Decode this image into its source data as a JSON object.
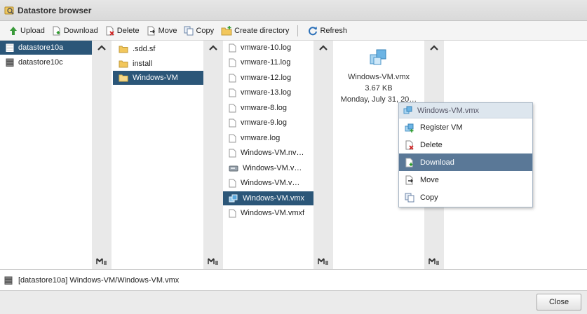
{
  "window": {
    "title": "Datastore browser"
  },
  "toolbar": {
    "upload": "Upload",
    "download": "Download",
    "delete": "Delete",
    "move": "Move",
    "copy": "Copy",
    "create_directory": "Create directory",
    "refresh": "Refresh"
  },
  "datastores": [
    "datastore10a",
    "datastore10c"
  ],
  "folders": [
    ".sdd.sf",
    "install",
    "Windows-VM"
  ],
  "files": [
    "vmware-10.log",
    "vmware-11.log",
    "vmware-12.log",
    "vmware-13.log",
    "vmware-8.log",
    "vmware-9.log",
    "vmware.log",
    "Windows-VM.nv…",
    "Windows-VM.v…",
    "Windows-VM.v…",
    "Windows-VM.vmx",
    "Windows-VM.vmxf"
  ],
  "preview": {
    "name": "Windows-VM.vmx",
    "size": "3.67 KB",
    "date": "Monday, July 31, 20…"
  },
  "context_menu": {
    "header": "Windows-VM.vmx",
    "register_vm": "Register VM",
    "delete": "Delete",
    "download": "Download",
    "move": "Move",
    "copy": "Copy"
  },
  "status": {
    "path": "[datastore10a] Windows-VM/Windows-VM.vmx"
  },
  "footer": {
    "close": "Close"
  },
  "colors": {
    "selection": "#2b5678",
    "menu_highlight": "#5a7897",
    "rail": "#e9e9e9"
  }
}
